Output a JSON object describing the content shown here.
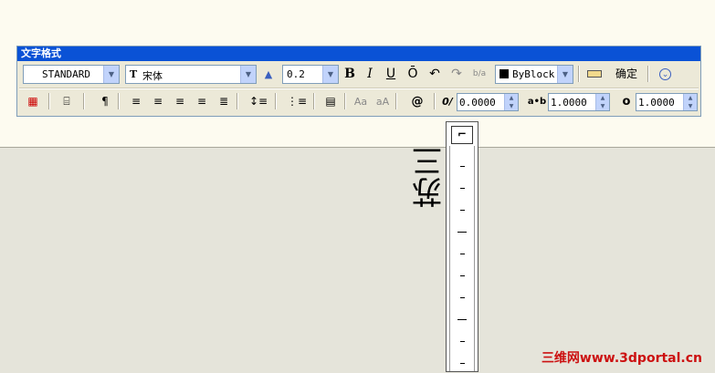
{
  "toolbar": {
    "title": "文字格式",
    "style_value": "STANDARD",
    "font_value": "宋体",
    "font_prefix": "T",
    "height_value": "0.2",
    "bold": "B",
    "italic": "I",
    "underline": "U",
    "overline": "Ō",
    "undo": "↶",
    "redo": "↷",
    "stack": "b/a",
    "color_value": "ByBlock",
    "ok_label": "确定",
    "options_glyph": "⌄"
  },
  "row2": {
    "symbol": "@",
    "oblique_value": "0.0000",
    "tracking_value": "1.0000",
    "width_value": "1.0000",
    "oblique_icon": "0/",
    "tracking_icon": "a•b",
    "width_icon": "o",
    "upper_label": "Aa",
    "lower_label": "aA"
  },
  "editor": {
    "vertical_text": "苏三"
  },
  "watermark": "三维网www.3dportal.cn"
}
